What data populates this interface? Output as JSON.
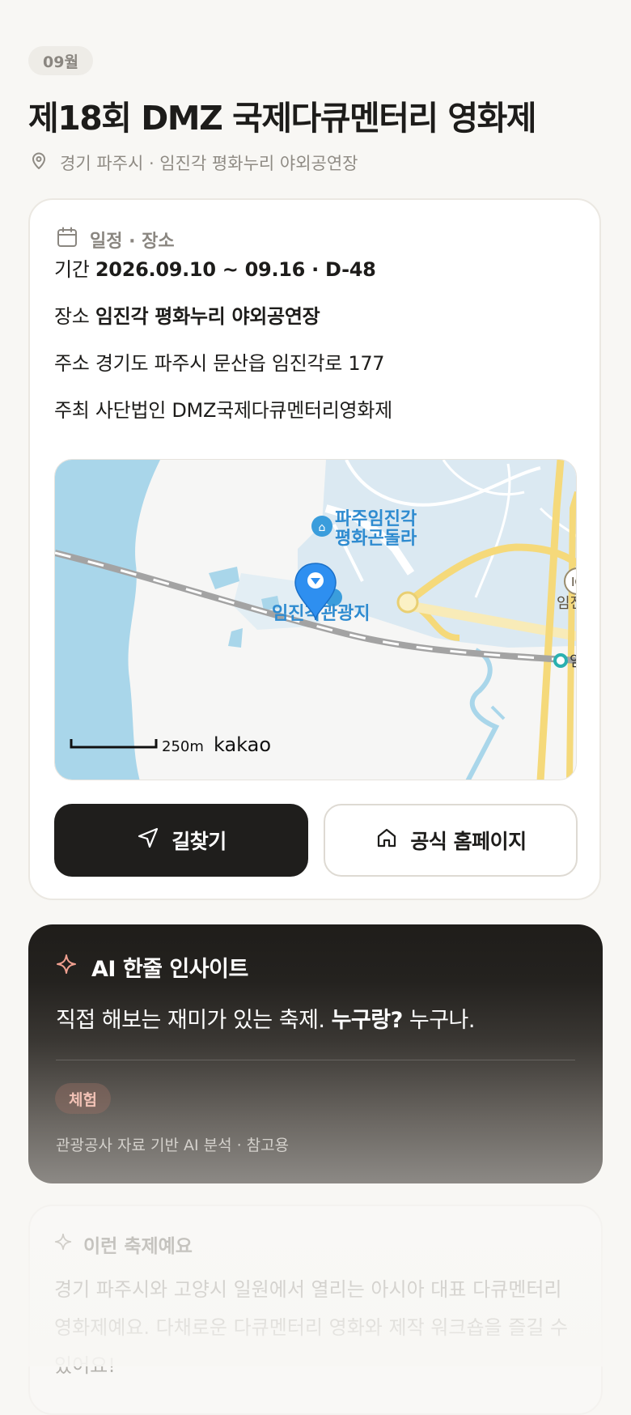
{
  "header": {
    "month_chip": "09월",
    "title": "제18회 DMZ 국제다큐멘터리 영화제",
    "location": "경기 파주시 · 임진각 평화누리 야외공연장"
  },
  "info_card": {
    "header": "일정 · 장소",
    "rows": [
      {
        "label": "기간",
        "value": "2026.09.10 ~ 09.16 · D-48",
        "bold": true
      },
      {
        "label": "장소",
        "value": "임진각 평화누리 야외공연장",
        "bold": true
      },
      {
        "label": "주소",
        "value": "경기도 파주시 문산읍 임진각로 177",
        "bold": false
      },
      {
        "label": "주최",
        "value": "사단법인 DMZ국제다큐멘터리영화제",
        "bold": false
      }
    ],
    "map": {
      "poi_gondola_line1": "파주임진각",
      "poi_gondola_line2": "평화곤돌라",
      "poi_main": "임진각관광지",
      "edge_label_top": "IC",
      "edge_label_mid": "임진",
      "edge_label_bottom": "임",
      "scale_label": "250m",
      "brand": "kakao"
    },
    "buttons": {
      "directions": "길찾기",
      "homepage": "공식 홈페이지"
    }
  },
  "ai_card": {
    "title": "AI 한줄 인사이트",
    "text_part1": "직접 해보는 재미가 있는 축제.",
    "text_bold": "누구랑?",
    "text_part2": "누구나.",
    "tag": "체험",
    "note": "관광공사 자료 기반 AI 분석 · 참고용"
  },
  "about_card": {
    "title": "이런 축제예요",
    "text": "경기 파주시와 고양시 일원에서 열리는 아시아 대표 다큐멘터리 영화제예요. 다채로운 다큐멘터리 영화와 제작 워크숍을 즐길 수 있어요!"
  },
  "colors": {
    "background": "#f8f7f4",
    "primary_dark": "#1f1e1c",
    "muted_text": "#8f8b84",
    "map_water": "#a8d8ea",
    "map_road": "#f5d97a",
    "pin_blue": "#2e8ff0",
    "ai_accent": "#f0a090"
  },
  "icons": {
    "location": "map-pin-icon",
    "calendar": "calendar-icon",
    "directions": "navigation-arrow-icon",
    "homepage": "home-icon",
    "ai": "sparkle-icon"
  }
}
